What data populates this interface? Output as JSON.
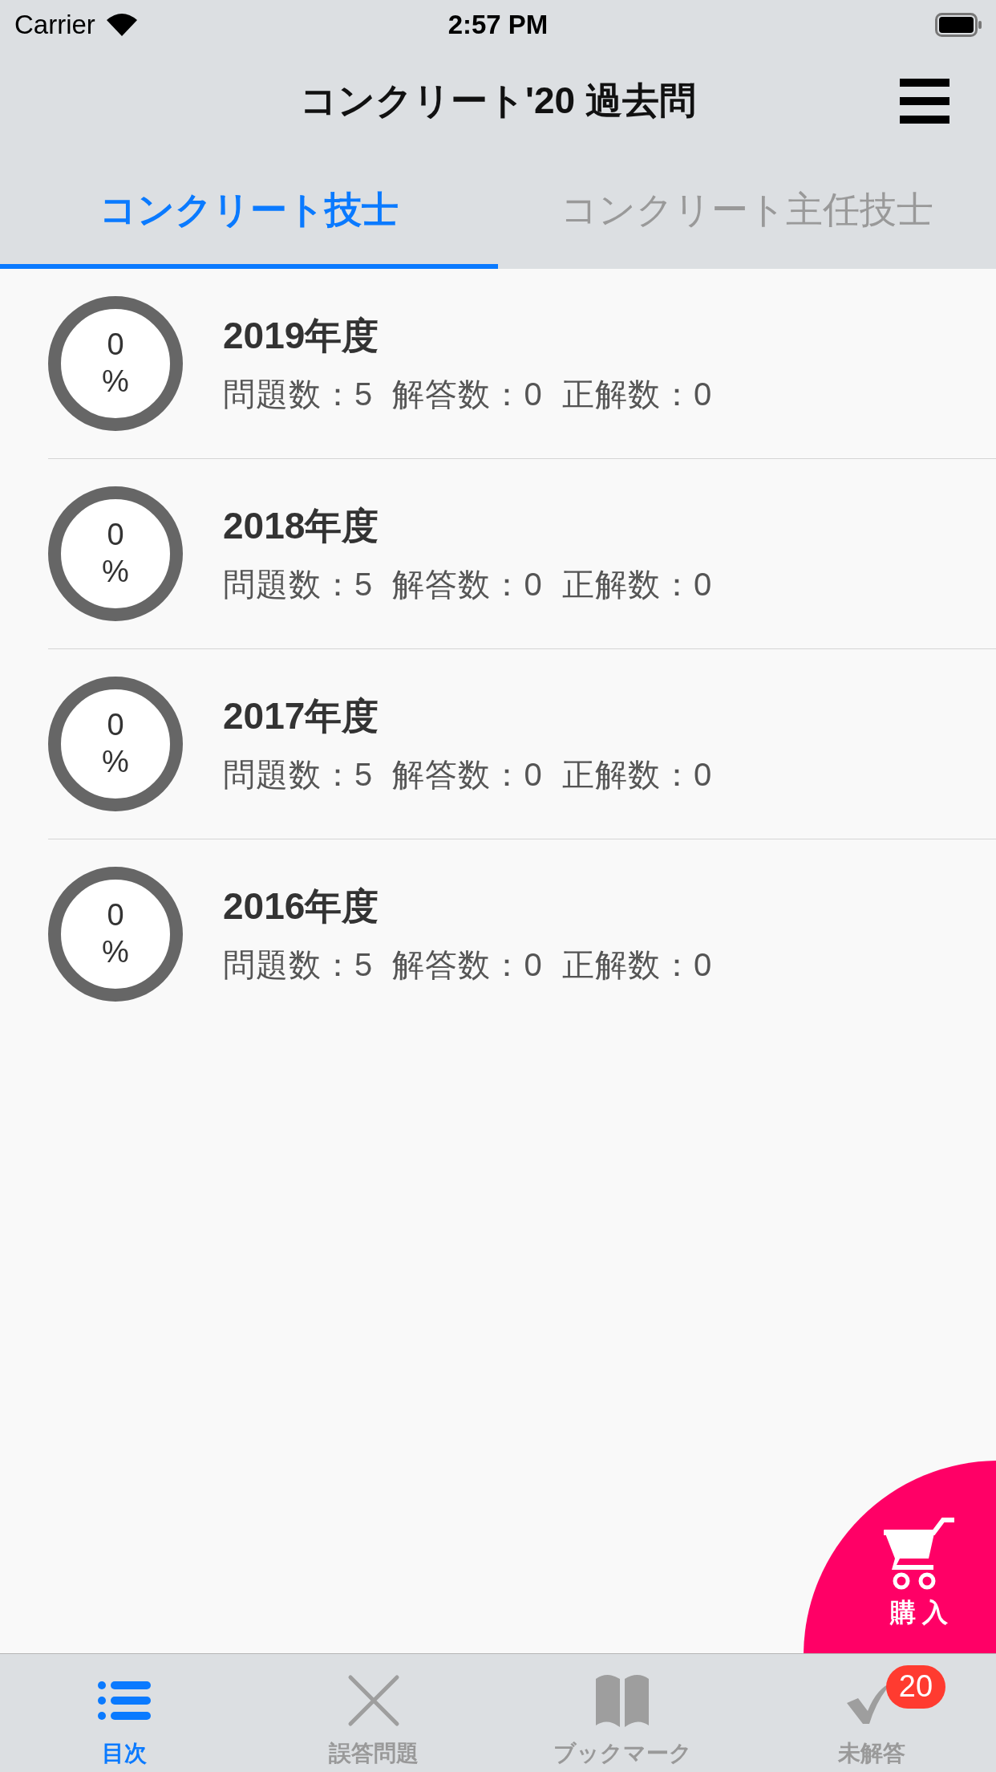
{
  "status_bar": {
    "carrier": "Carrier",
    "time": "2:57 PM"
  },
  "nav": {
    "title": "コンクリート'20 過去問"
  },
  "tabs": [
    {
      "label": "コンクリート技士",
      "selected": true
    },
    {
      "label": "コンクリート主任技士",
      "selected": false
    }
  ],
  "rows": [
    {
      "percent": "0",
      "unit": "%",
      "title": "2019年度",
      "stats": "問題数：5  解答数：0  正解数：0"
    },
    {
      "percent": "0",
      "unit": "%",
      "title": "2018年度",
      "stats": "問題数：5  解答数：0  正解数：0"
    },
    {
      "percent": "0",
      "unit": "%",
      "title": "2017年度",
      "stats": "問題数：5  解答数：0  正解数：0"
    },
    {
      "percent": "0",
      "unit": "%",
      "title": "2016年度",
      "stats": "問題数：5  解答数：0  正解数：0"
    }
  ],
  "purchase": {
    "label": "購入"
  },
  "tab_bar": [
    {
      "kind": "list",
      "label": "目次",
      "selected": true
    },
    {
      "kind": "cross",
      "label": "誤答問題",
      "selected": false
    },
    {
      "kind": "book",
      "label": "ブックマーク",
      "selected": false
    },
    {
      "kind": "check",
      "label": "未解答",
      "selected": false,
      "badge": "20"
    }
  ]
}
